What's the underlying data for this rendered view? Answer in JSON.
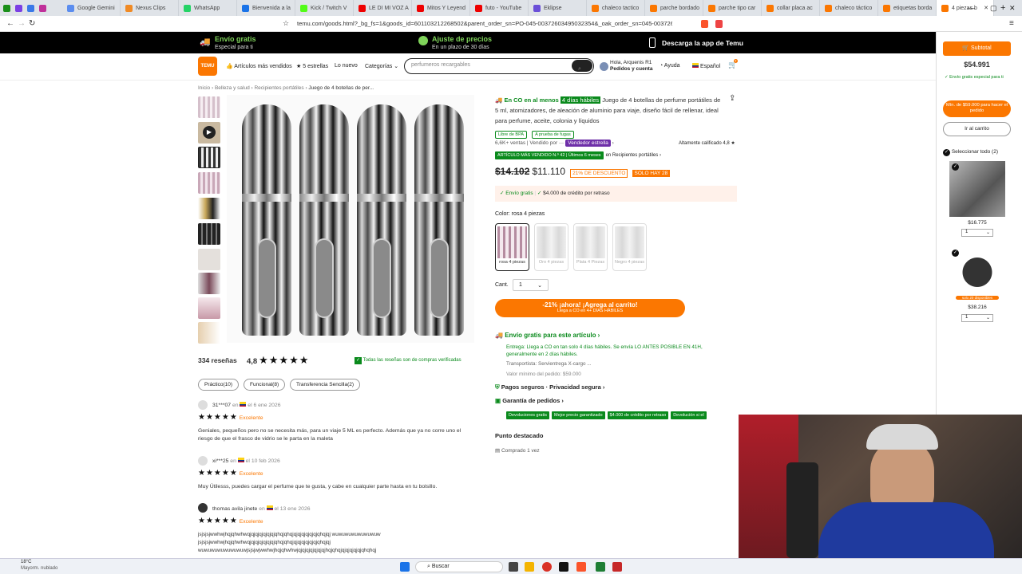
{
  "browser": {
    "tabs": [
      "Google Gemini",
      "Nexus Clips",
      "WhatsApp",
      "Bienvenida a la",
      "Kick / Twitch V",
      "LE DI MI VOZ A",
      "Mitos Y Leyend",
      "futo - YouTube",
      "Eklipse",
      "chaleco tactico",
      "parche bordado",
      "parche tipo car",
      "collar placa ac",
      "chaleco táctico",
      "etiquetas borda",
      "4 piezas b"
    ],
    "url": "temu.com/goods.html?_bg_fs=1&goods_id=601103212268502&parent_order_sn=PO-045-00372603495032354&_oak_order_sn=045-0037262..."
  },
  "promo": {
    "free_ship": "Envío gratis",
    "free_ship_sub": "Especial para ti",
    "adjust": "Ajuste de precios",
    "adjust_sub": "En un plazo de 30 días",
    "app": "Descarga la app de Temu"
  },
  "header": {
    "logo": "TEMU",
    "nav": [
      "Artículos más vendidos",
      "5 estrellas",
      "Lo nuevo",
      "Categorías"
    ],
    "search_placeholder": "perfumeros recargables",
    "account_greet": "Hola, Arquenis R1",
    "account_sub": "Pedidos y cuenta",
    "help": "Ayuda",
    "lang": "Español",
    "cart_count": "7"
  },
  "breadcrumb": [
    "Inicio",
    "Belleza y salud",
    "Recipientes portátiles",
    "Juego de 4 botellas de per..."
  ],
  "product": {
    "delivery_prefix": "En CO en al menos",
    "delivery_days": "4 días hábiles",
    "title": "Juego de 4 botellas de perfume portátiles de 5 ml, atomizadores, de aleación de aluminio para viaje, diseño fácil de rellenar, ideal para perfume, aceite, colonia y líquidos",
    "chips": [
      "Libre de BPA",
      "A prueba de fugas"
    ],
    "sales": "6,6K+ ventas | Vendido por",
    "seller_badge": "Vendedor estrella",
    "rating_label": "Altamente calificado 4,8",
    "bestseller": "ARTÍCULO MÁS VENDIDO N.º 42 | Últimos 6 meses",
    "bestseller_cat": "en Recipientes portátiles",
    "old_price": "$14.102",
    "price": "$11.110",
    "discount": "21% DE DESCUENTO",
    "stock": "SOLO HAY 28",
    "ship_free": "Envío gratis",
    "credit": "$4.000 de crédito por retraso",
    "color_label": "Color: rosa 4 piezas",
    "colors": [
      "rosa 4 piezas",
      "Oro 4 piezas",
      "Plata 4 Piezas",
      "Negro 4 piezas"
    ],
    "qty_label": "Cant.",
    "qty": "1",
    "add_btn": "-21% ¡ahora! ¡Agrega al carrito!",
    "add_sub": "Llega a CO en 4+ DÍAS HÁBILES",
    "ship_title": "Envío gratis para este artículo",
    "ship_detail": "Entrega: Llega a CO en tan solo 4 días hábiles. Se envía LO ANTES POSIBLE EN 41H, generalmente en 2 días hábiles.",
    "carrier": "Transportista:  Servientrega  X-cargo ...",
    "min_order": "Valor mínimo del pedido: $59.000",
    "secure": "Pagos seguros · Privacidad segura",
    "guarantee": "Garantía de pedidos",
    "guarantee_tags": [
      "Devoluciones gratis",
      "Mejor precio garantizado",
      "$4.000 de crédito por retraso",
      "Devolución si el"
    ],
    "highlight_title": "Punto destacado",
    "highlight_item": "Comprado 1 vez"
  },
  "reviews": {
    "count": "334 reseñas",
    "score": "4,8",
    "verified": "Todas las reseñas son de compras verificadas",
    "filters": [
      "Práctico(10)",
      "Funcional(8)",
      "Transferencia Sencilla(2)"
    ],
    "items": [
      {
        "user": "31***07",
        "date": "el 6 ene 2026",
        "label": "Excelente",
        "text": "Geniales, pequeños pero no se necesita más, para un viaje 5 ML es perfecto. Además que ya no corre uno el",
        "text2": "riesgo de que el frasco de vidrio se le parta en la maleta"
      },
      {
        "user": "xi***25",
        "date": "el 10 feb 2026",
        "label": "Excelente",
        "text": "Muy Útilesss, puedes cargar el perfume que te gusta, y cabe en cualquier parte hasta en tu bolsillo.",
        "text2": ""
      },
      {
        "user": "thomas avila jinete",
        "date": "el 13 ene 2026",
        "label": "Excelente",
        "text": "jsjsjsjwwhwjhqjqhwhwqjqjqjqjqjqjqjqhqjqhqjqjqjqjqjqjqjqhqjqj wuwuwuwuwuwuwuw",
        "text2": "jsjsjsjwwhwjhqjqhwhwqjqjqjqjqjqjqjqhqjqhqjqjqjqjqjqjqjqhqjqj",
        "text3": "wuwuwuwuwuwuwuwjsjsjwjwwhwjhqjqhwhwjqjqjqjqjqjqjqjhqjqhqjqjqjqjqjqjqhqhqj"
      }
    ]
  },
  "cart": {
    "subtotal_label": "Subtotal",
    "subtotal": "$54.991",
    "free_ship": "Envío gratis especial para ti",
    "min_btn": "Mín. de $59.000 para hacer el pedido",
    "go_cart": "Ir al carrito",
    "select_all": "Seleccionar todo (2)",
    "items": [
      {
        "price": "$16.775",
        "qty": "1"
      },
      {
        "price": "$38.216",
        "qty": "1",
        "note": "solo 20 disponibles"
      }
    ]
  },
  "taskbar": {
    "weather_temp": "18°C",
    "weather_desc": "Mayorm. nublado",
    "search": "Buscar"
  },
  "colors": {
    "accent": "#fb7701",
    "green": "#0a8a1c",
    "purple": "#6e2fa8"
  }
}
